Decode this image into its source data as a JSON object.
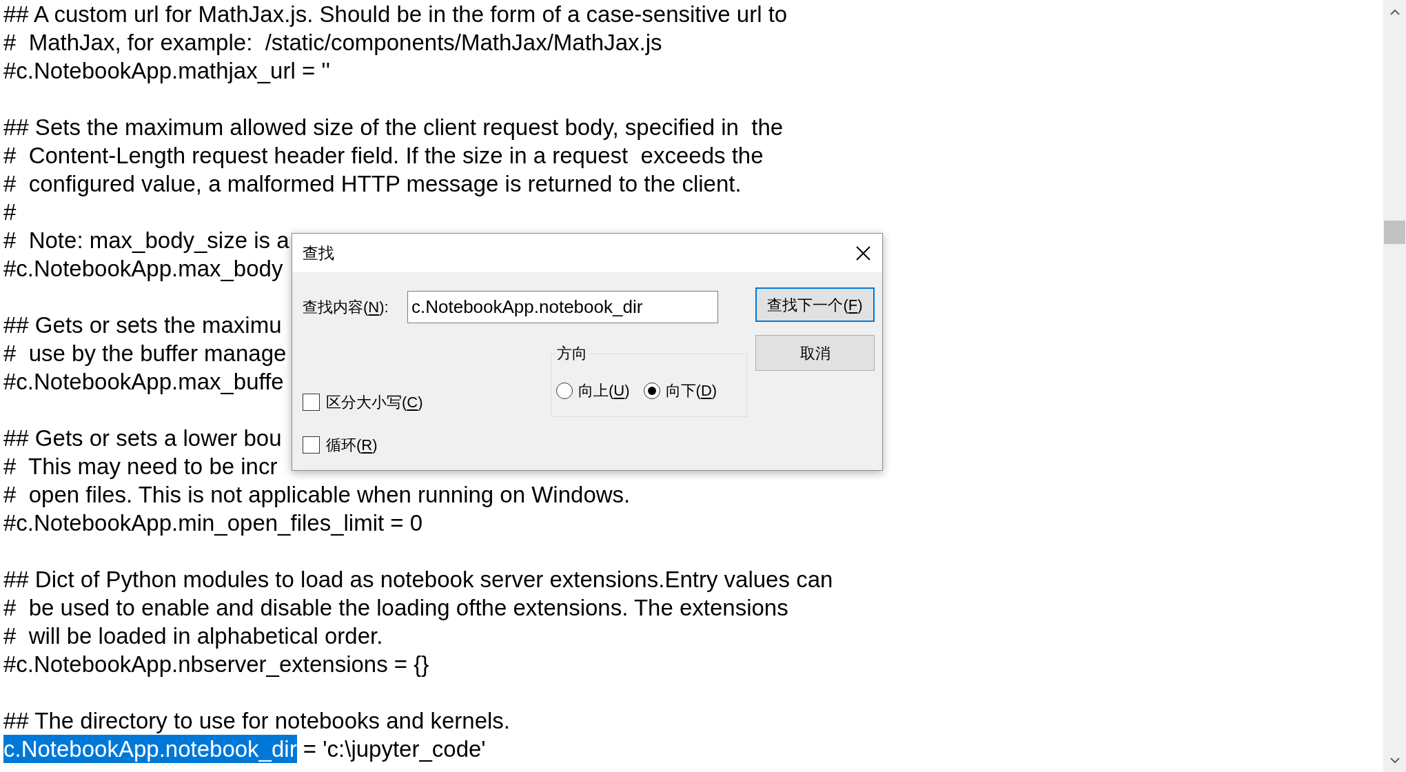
{
  "editor": {
    "blocks": [
      {
        "lines": [
          {
            "text": "## A custom url for MathJax.js. Should be in the form of a case-sensitive url to"
          },
          {
            "text": "#  MathJax, for example:  /static/components/MathJax/MathJax.js"
          },
          {
            "text": "#c.NotebookApp.mathjax_url = ''"
          }
        ]
      },
      {
        "lines": [
          {
            "text": "## Sets the maximum allowed size of the client request body, specified in  the"
          },
          {
            "text": "#  Content-Length request header field. If the size in a request  exceeds the"
          },
          {
            "text": "#  configured value, a malformed HTTP message is returned to the client."
          },
          {
            "text": "#"
          },
          {
            "text": "#  Note: max_body_size is a"
          },
          {
            "text": "#c.NotebookApp.max_body"
          }
        ]
      },
      {
        "lines": [
          {
            "text": "## Gets or sets the maximu"
          },
          {
            "text": "#  use by the buffer manage"
          },
          {
            "text": "#c.NotebookApp.max_buffe"
          }
        ]
      },
      {
        "lines": [
          {
            "text": "## Gets or sets a lower bou"
          },
          {
            "text": "#  This may need to be incr"
          },
          {
            "text": "#  open files. This is not applicable when running on Windows."
          },
          {
            "text": "#c.NotebookApp.min_open_files_limit = 0"
          }
        ]
      },
      {
        "lines": [
          {
            "text": "## Dict of Python modules to load as notebook server extensions.Entry values can"
          },
          {
            "text": "#  be used to enable and disable the loading ofthe extensions. The extensions"
          },
          {
            "text": "#  will be loaded in alphabetical order."
          },
          {
            "text": "#c.NotebookApp.nbserver_extensions = {}"
          }
        ]
      },
      {
        "lines": [
          {
            "text": "## The directory to use for notebooks and kernels."
          },
          {
            "segments": [
              {
                "text": "c.NotebookApp.notebook_dir",
                "selected": true
              },
              {
                "text": " = 'c:\\jupyter_code'",
                "selected": false
              }
            ]
          }
        ]
      }
    ]
  },
  "dialog": {
    "title": "查找",
    "find_field": {
      "label": {
        "before": "查找内容(",
        "key": "N",
        "after": "):"
      },
      "value": "c.NotebookApp.notebook_dir"
    },
    "options": [
      {
        "label": {
          "before": "区分大小写(",
          "key": "C",
          "after": ")"
        },
        "checked": false
      },
      {
        "label": {
          "before": "循环(",
          "key": "R",
          "after": ")"
        },
        "checked": false
      }
    ],
    "direction": {
      "title": "方向",
      "options": [
        {
          "label": {
            "before": "向上(",
            "key": "U",
            "after": ")"
          },
          "selected": false
        },
        {
          "label": {
            "before": "向下(",
            "key": "D",
            "after": ")"
          },
          "selected": true
        }
      ]
    },
    "buttons": [
      {
        "label": {
          "before": "查找下一个(",
          "key": "F",
          "after": ")"
        },
        "focused": true
      },
      {
        "label": {
          "before": "取消"
        },
        "focused": false
      }
    ]
  }
}
